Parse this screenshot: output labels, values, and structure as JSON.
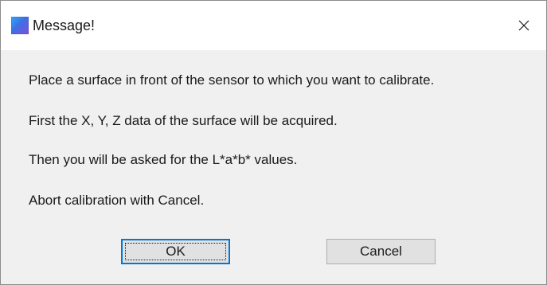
{
  "window": {
    "title": "Message!",
    "app_icon": "app-icon",
    "close_icon": "close-icon"
  },
  "message": {
    "lines": [
      "Place a surface in front of the sensor to which you want to calibrate.",
      "First the X, Y, Z data of the surface will be acquired.",
      "Then you will be asked for the L*a*b* values.",
      "Abort calibration with Cancel."
    ]
  },
  "buttons": {
    "ok_label": "OK",
    "cancel_label": "Cancel"
  },
  "colors": {
    "focus_border": "#0078d7",
    "dialog_bg": "#f0f0f0",
    "titlebar_bg": "#ffffff"
  }
}
